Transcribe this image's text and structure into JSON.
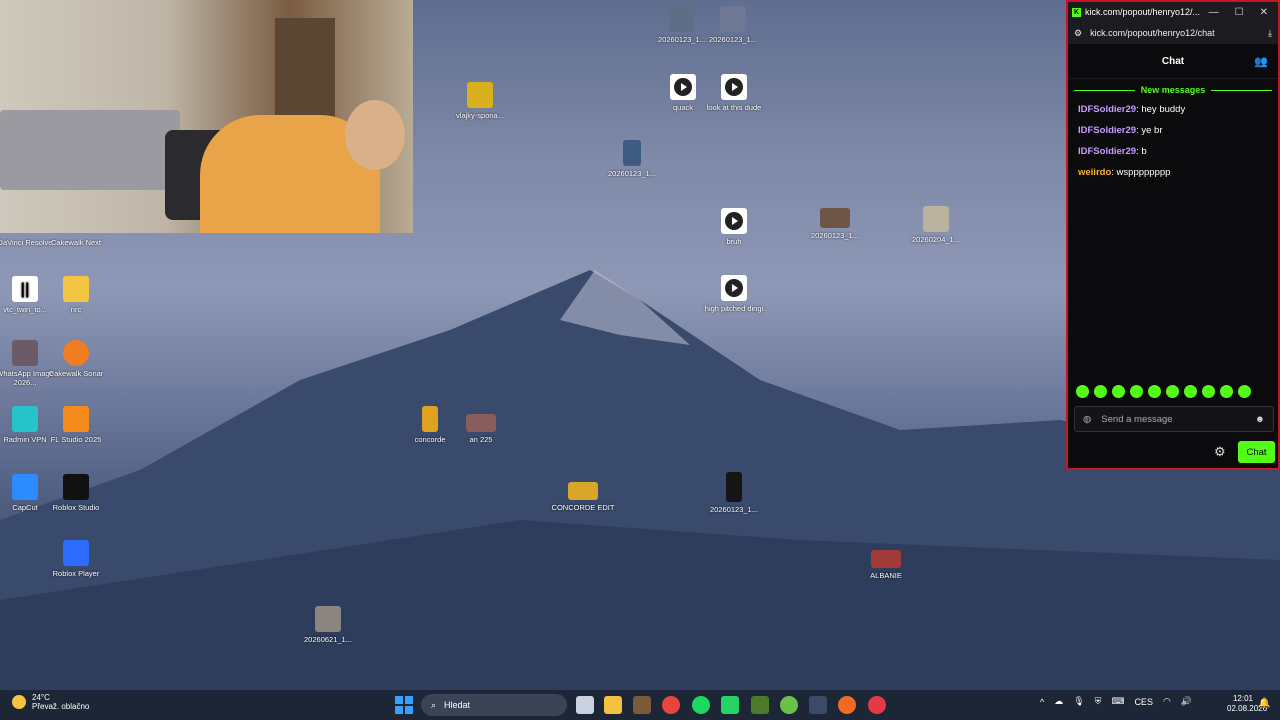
{
  "webcam": {
    "label": "webcam-overlay"
  },
  "desktop_icons": [
    {
      "label": "DaVinci Resolve",
      "icon": "davinci-icon"
    },
    {
      "label": "Cakewalk Next",
      "icon": "cakewalk-icon"
    },
    {
      "label": "vtc_twin_to...",
      "icon": "file-icon"
    },
    {
      "label": "nrc",
      "icon": "folder-icon"
    },
    {
      "label": "WhatsApp Image 2026...",
      "icon": "image-icon"
    },
    {
      "label": "Cakewalk Sonar",
      "icon": "cakewalk-icon"
    },
    {
      "label": "Radmin VPN",
      "icon": "vpn-icon"
    },
    {
      "label": "FL Studio 2025",
      "icon": "flstudio-icon"
    },
    {
      "label": "CapCut",
      "icon": "capcut-icon"
    },
    {
      "label": "Roblox Studio",
      "icon": "roblox-studio-icon"
    },
    {
      "label": "Roblox Player",
      "icon": "roblox-player-icon"
    },
    {
      "label": "20260123_1...",
      "icon": "image-icon"
    },
    {
      "label": "20260123_1...",
      "icon": "image-icon"
    },
    {
      "label": "vlajky-spona...",
      "icon": "image-icon"
    },
    {
      "label": "quack",
      "icon": "audio-icon"
    },
    {
      "label": "look at this dude",
      "icon": "audio-icon"
    },
    {
      "label": "20260123_1...",
      "icon": "image-icon"
    },
    {
      "label": "bruh",
      "icon": "audio-icon"
    },
    {
      "label": "20260123_1...",
      "icon": "video-icon"
    },
    {
      "label": "20260204_1...",
      "icon": "image-icon"
    },
    {
      "label": "high pitched dingi",
      "icon": "audio-icon"
    },
    {
      "label": "concorde",
      "icon": "image-icon"
    },
    {
      "label": "an 225",
      "icon": "video-icon"
    },
    {
      "label": "CONCORDE EDIT",
      "icon": "video-icon"
    },
    {
      "label": "20260123_1...",
      "icon": "image-icon"
    },
    {
      "label": "ALBANIE",
      "icon": "video-icon"
    },
    {
      "label": "20260621_1...",
      "icon": "image-icon"
    }
  ],
  "chat": {
    "window_title": "kick.com/popout/henryo12/...",
    "url": "kick.com/popout/henryo12/chat",
    "header": "Chat",
    "new_messages_label": "New messages",
    "messages": [
      {
        "user": "IDFSoldier29",
        "sep": ":",
        "text": " hey buddy"
      },
      {
        "user": "IDFSoldier29",
        "sep": ":",
        "text": " ye br"
      },
      {
        "user": "IDFSoldier29",
        "sep": ":",
        "text": " b"
      },
      {
        "user": "weiirdo",
        "sep": ":",
        "text": " wspppppppp"
      }
    ],
    "input_placeholder": "Send a message",
    "send_label": "Chat",
    "accent": "#53fc18"
  },
  "taskbar": {
    "weather_temp": "24°C",
    "weather_desc": "Převaž. oblačno",
    "search_placeholder": "Hledat",
    "lang": "CES",
    "time": "12:01",
    "date": "02.08.2026"
  }
}
